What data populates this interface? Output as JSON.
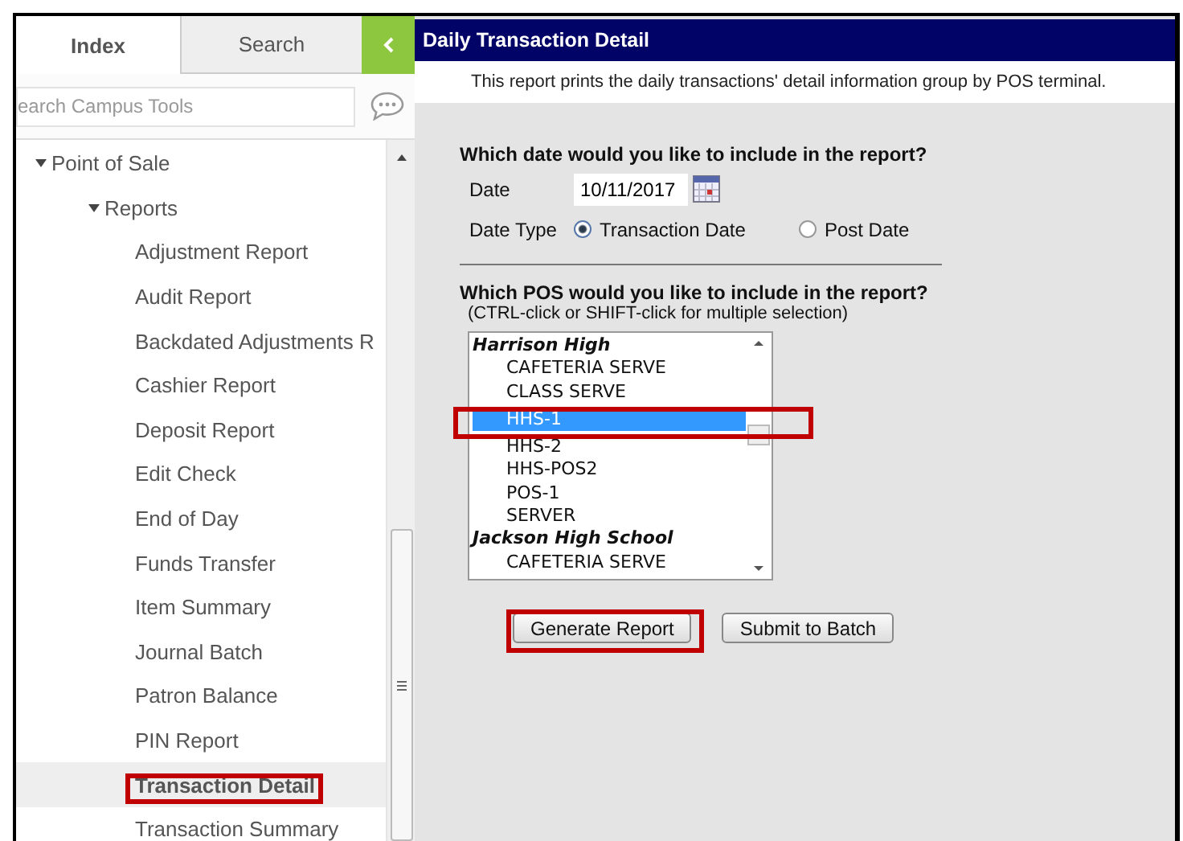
{
  "sidebar": {
    "tabs": [
      {
        "label": "Index",
        "selected": true
      },
      {
        "label": "Search",
        "selected": false
      }
    ],
    "search": {
      "placeholder": "earch Campus Tools"
    },
    "tree": [
      {
        "label": "Point of Sale",
        "expanded": true,
        "children": [
          {
            "label": "Reports",
            "expanded": true,
            "children": [
              {
                "label": "Adjustment Report",
                "selected": false
              },
              {
                "label": "Audit Report",
                "selected": false
              },
              {
                "label": "Backdated Adjustments R",
                "selected": false
              },
              {
                "label": "Cashier Report",
                "selected": false
              },
              {
                "label": "Deposit Report",
                "selected": false
              },
              {
                "label": "Edit Check",
                "selected": false
              },
              {
                "label": "End of Day",
                "selected": false
              },
              {
                "label": "Funds Transfer",
                "selected": false
              },
              {
                "label": "Item Summary",
                "selected": false
              },
              {
                "label": "Journal Batch",
                "selected": false
              },
              {
                "label": "Patron Balance",
                "selected": false
              },
              {
                "label": "PIN Report",
                "selected": false
              },
              {
                "label": "Transaction Detail",
                "selected": true,
                "highlighted": true
              },
              {
                "label": "Transaction Summary",
                "selected": false
              }
            ]
          }
        ]
      }
    ]
  },
  "report": {
    "title": "Daily Transaction Detail",
    "description": "This report prints the daily transactions' detail information group by POS terminal.",
    "date_section": {
      "heading": "Which date would you like to include in the report?",
      "date_label": "Date",
      "date_value": "10/11/2017",
      "type_label": "Date Type",
      "date_types": [
        {
          "label": "Transaction Date",
          "selected": true
        },
        {
          "label": "Post Date",
          "selected": false
        }
      ]
    },
    "pos_section": {
      "heading": "Which POS would you like to include in the report?",
      "hint": "(CTRL-click or SHIFT-click for multiple selection)",
      "groups": [
        {
          "label": "Harrison High",
          "options": [
            {
              "label": "CAFETERIA SERVE",
              "selected": false
            },
            {
              "label": "CLASS SERVE",
              "selected": false
            },
            {
              "label": "HHS-1",
              "selected": true,
              "highlighted": true
            },
            {
              "label": "HHS-2",
              "selected": false
            },
            {
              "label": "HHS-POS2",
              "selected": false
            },
            {
              "label": "POS-1",
              "selected": false
            },
            {
              "label": "SERVER",
              "selected": false
            }
          ]
        },
        {
          "label": "Jackson High School",
          "options": [
            {
              "label": "CAFETERIA SERVE",
              "selected": false
            }
          ]
        }
      ]
    },
    "buttons": [
      {
        "label": "Generate Report",
        "highlighted": true
      },
      {
        "label": "Submit to Batch",
        "highlighted": false
      }
    ]
  }
}
